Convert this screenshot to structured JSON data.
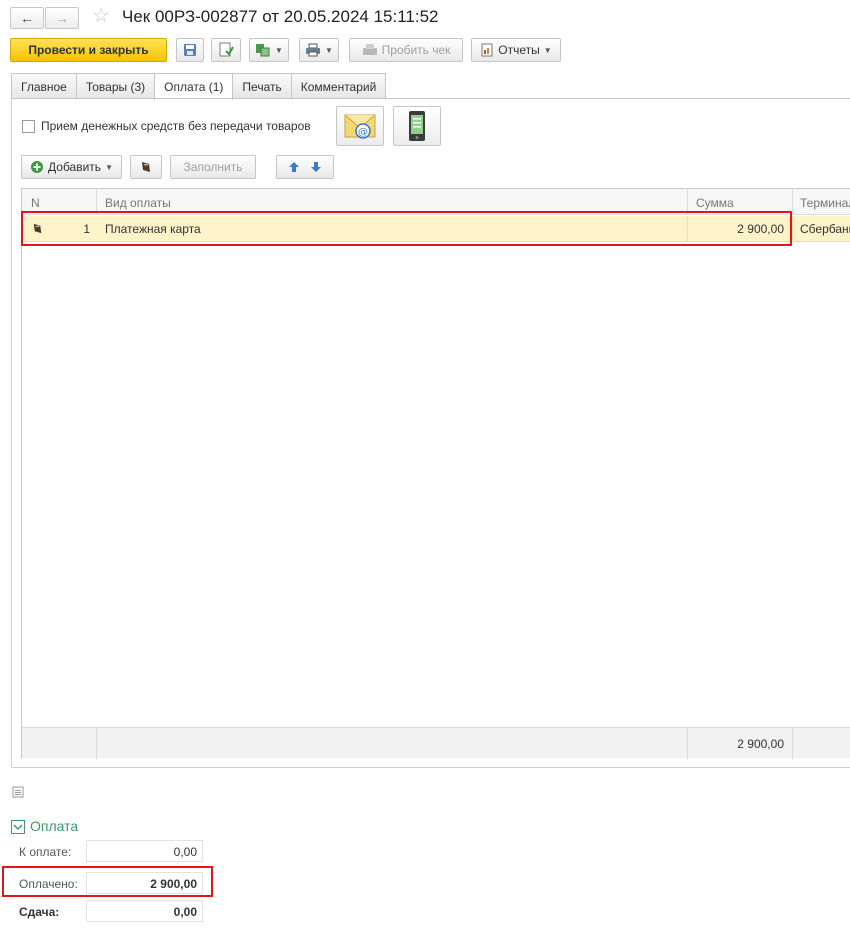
{
  "window": {
    "title": "Чек 00РЗ-002877 от 20.05.2024 15:11:52"
  },
  "toolbar": {
    "post_close_label": "Провести и закрыть",
    "print_receipt_label": "Пробить чек",
    "reports_label": "Отчеты"
  },
  "tabs": [
    {
      "label": "Главное"
    },
    {
      "label": "Товары (3)"
    },
    {
      "label": "Оплата (1)",
      "active": true
    },
    {
      "label": "Печать"
    },
    {
      "label": "Комментарий"
    }
  ],
  "payment": {
    "checkbox_label": "Прием денежных средств без передачи товаров",
    "add_label": "Добавить",
    "fill_label": "Заполнить"
  },
  "grid": {
    "columns": [
      "N",
      "Вид оплаты",
      "Сумма",
      "Терминал"
    ],
    "rows": [
      {
        "n": "1",
        "type": "Платежная карта",
        "amount": "2 900,00",
        "terminal": "Сбербанк"
      }
    ],
    "footer_total": "2 900,00"
  },
  "summary": {
    "section_title": "Оплата",
    "to_pay_label": "К оплате:",
    "to_pay_value": "0,00",
    "paid_label": "Оплачено:",
    "paid_value": "2 900,00",
    "change_label": "Сдача:",
    "change_value": "0,00"
  },
  "colors": {
    "primary_button": "#f4c400",
    "selected_row": "#fcf3c8",
    "highlight_box": "#e0161c",
    "section_title": "#3a9a6e"
  }
}
